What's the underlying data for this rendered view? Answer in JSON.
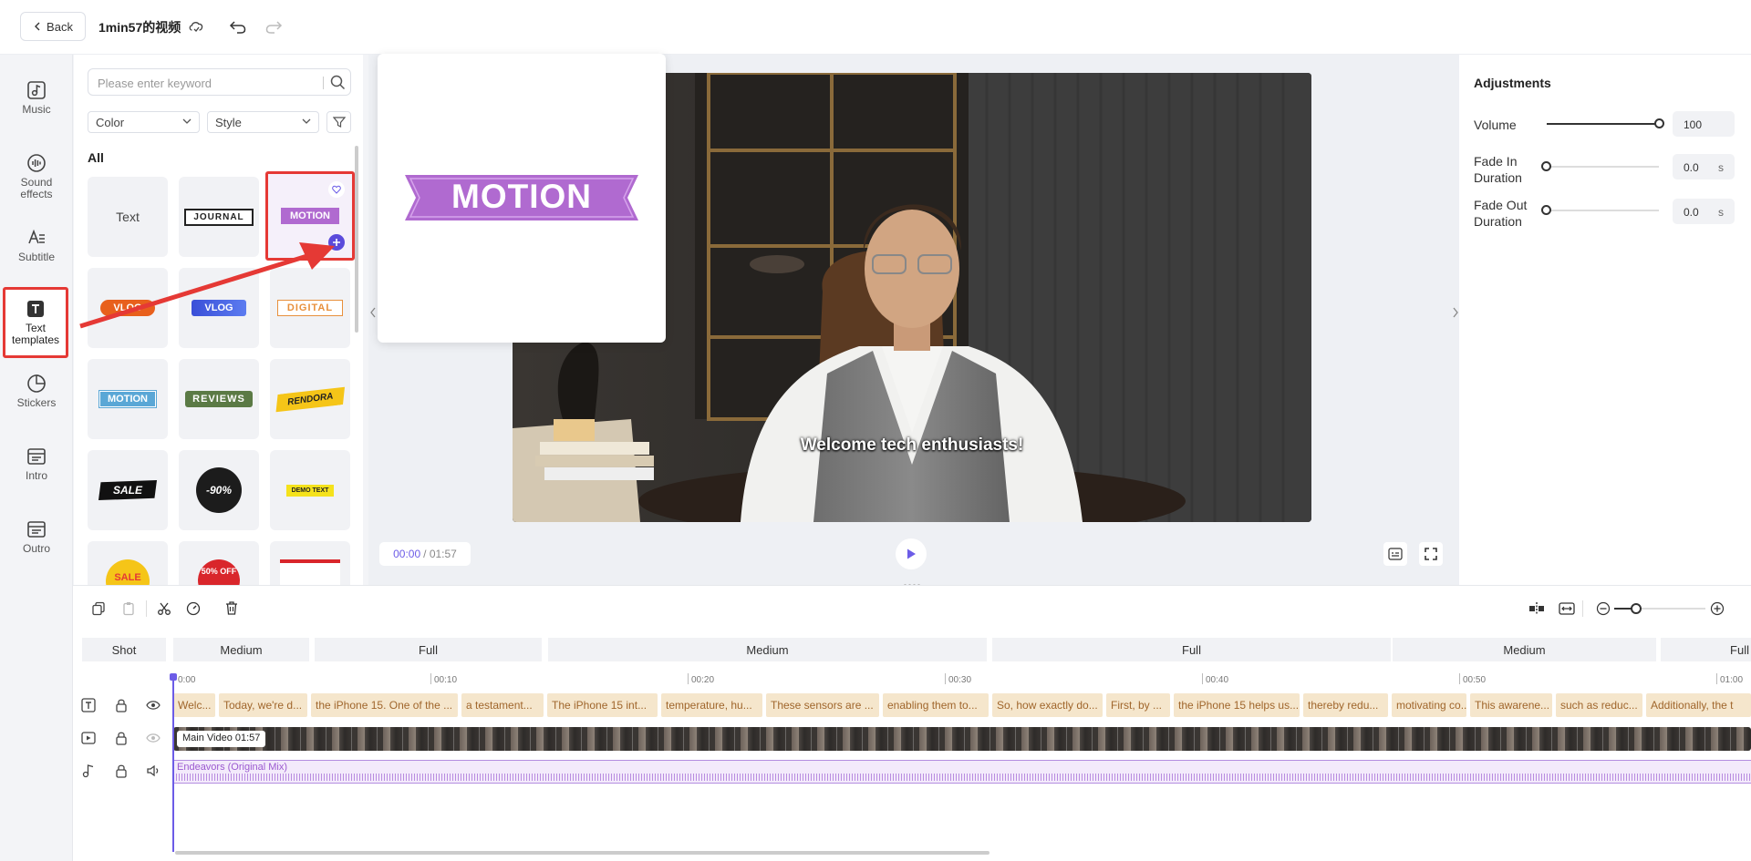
{
  "topbar": {
    "back_label": "Back",
    "project_title": "1min57的视频"
  },
  "leftnav": {
    "items": [
      {
        "label": "Music",
        "icon": "music-icon"
      },
      {
        "label": "Sound effects",
        "icon": "sound-effects-icon"
      },
      {
        "label": "Subtitle",
        "icon": "subtitle-icon"
      },
      {
        "label": "Text templates",
        "icon": "text-templates-icon",
        "active": true
      },
      {
        "label": "Stickers",
        "icon": "stickers-icon"
      },
      {
        "label": "Intro",
        "icon": "intro-icon"
      },
      {
        "label": "Outro",
        "icon": "outro-icon"
      }
    ]
  },
  "panel": {
    "search_placeholder": "Please enter keyword",
    "color_select": "Color",
    "style_select": "Style",
    "section_title": "All",
    "templates": [
      {
        "label": "Text"
      },
      {
        "label": "JOURNAL"
      },
      {
        "label": "MOTION"
      },
      {
        "label": "VLOG"
      },
      {
        "label": "VLOG"
      },
      {
        "label": "DIGITAL"
      },
      {
        "label": "MOTION"
      },
      {
        "label": "REVIEWS"
      },
      {
        "label": "RENDORA"
      },
      {
        "label": "SALE"
      },
      {
        "label": "-90%"
      },
      {
        "label": "DEMO TEXT"
      },
      {
        "label": "SALE"
      },
      {
        "label": "50% OFF"
      },
      {
        "label": ""
      }
    ]
  },
  "popup": {
    "preview_text": "MOTION"
  },
  "video": {
    "subtitle": "Welcome tech enthusiasts!",
    "current_time": "00:00",
    "total_time": "/ 01:57"
  },
  "adjustments": {
    "title": "Adjustments",
    "volume_label": "Volume",
    "volume_value": "100",
    "volume_level": 1.0,
    "fade_in_label": "Fade In Duration",
    "fade_in_value": "0.0",
    "fade_out_label": "Fade Out Duration",
    "fade_out_value": "0.0",
    "unit": "s"
  },
  "timeline": {
    "shot_label": "Shot",
    "shots": [
      "Medium",
      "Full",
      "Medium",
      "Full",
      "Medium",
      "Full"
    ],
    "ruler": [
      "0:00",
      "00:10",
      "00:20",
      "00:30",
      "00:40",
      "00:50",
      "01:00"
    ],
    "captions": [
      "Welc...",
      "Today, we're d...",
      "the iPhone 15. One of the ...",
      "a testament...",
      "The iPhone 15 int...",
      "temperature, hu...",
      "These sensors are ...",
      "enabling them to...",
      "So, how exactly do...",
      "First, by ...",
      "the iPhone 15 helps us...",
      "thereby redu...",
      "motivating co...",
      "This awarene...",
      "such as reduc...",
      "Additionally, the t"
    ],
    "video_track_label": "Main Video 01:57",
    "audio_track_label": "Endeavors (Original Mix)"
  },
  "colors": {
    "accent": "#6c5ce7",
    "highlight": "#e53935",
    "caption_bg": "#f5e6cc",
    "audio": "#9b59d0"
  }
}
